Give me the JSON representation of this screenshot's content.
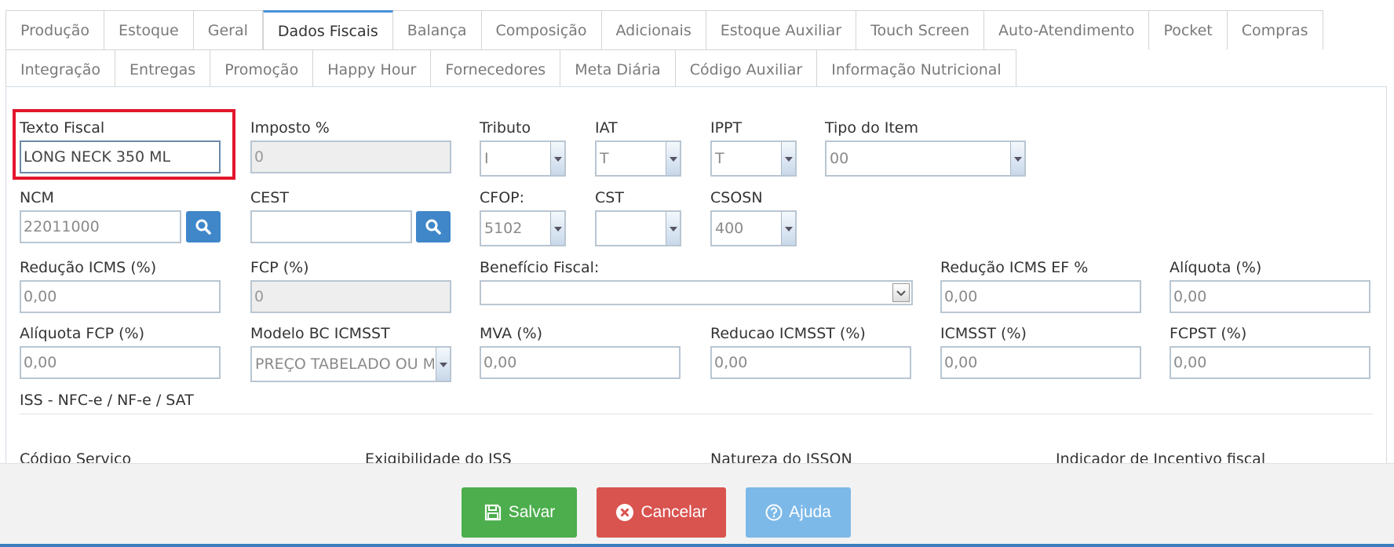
{
  "tabs_row1": [
    "Produção",
    "Estoque",
    "Geral",
    "Dados Fiscais",
    "Balança",
    "Composição",
    "Adicionais",
    "Estoque Auxiliar",
    "Touch Screen",
    "Auto-Atendimento",
    "Pocket",
    "Compras"
  ],
  "tabs_row2": [
    "Integração",
    "Entregas",
    "Promoção",
    "Happy Hour",
    "Fornecedores",
    "Meta Diária",
    "Código Auxiliar",
    "Informação Nutricional"
  ],
  "active_tab": "Dados Fiscais",
  "fields": {
    "texto_fiscal": {
      "label": "Texto Fiscal",
      "value": "LONG NECK 350 ML"
    },
    "imposto": {
      "label": "Imposto %",
      "value": "0"
    },
    "tributo": {
      "label": "Tributo",
      "value": "I"
    },
    "iat": {
      "label": "IAT",
      "value": "T"
    },
    "ippt": {
      "label": "IPPT",
      "value": "T"
    },
    "tipo_item": {
      "label": "Tipo do Item",
      "value": "00"
    },
    "ncm": {
      "label": "NCM",
      "value": "22011000"
    },
    "cest": {
      "label": "CEST",
      "value": ""
    },
    "cfop": {
      "label": "CFOP:",
      "value": "5102"
    },
    "cst": {
      "label": "CST",
      "value": ""
    },
    "csosn": {
      "label": "CSOSN",
      "value": "400"
    },
    "reducao_icms": {
      "label": "Redução ICMS (%)",
      "value": "0,00"
    },
    "fcp": {
      "label": "FCP (%)",
      "value": "0"
    },
    "beneficio_fiscal": {
      "label": "Benefício Fiscal:",
      "value": ""
    },
    "reducao_icms_ef": {
      "label": "Redução ICMS EF %",
      "value": "0,00"
    },
    "aliquota": {
      "label": "Alíquota (%)",
      "value": "0,00"
    },
    "aliquota_fcp": {
      "label": "Alíquota FCP (%)",
      "value": "0,00"
    },
    "modelo_bc": {
      "label": "Modelo BC ICMSST",
      "value": "PREÇO TABELADO OU MÁXIMO SUGERIDO"
    },
    "mva": {
      "label": "MVA (%)",
      "value": "0,00"
    },
    "reducao_icmsst": {
      "label": "Reducao ICMSST (%)",
      "value": "0,00"
    },
    "icmsst": {
      "label": "ICMSST (%)",
      "value": "0,00"
    },
    "fcpst": {
      "label": "FCPST (%)",
      "value": "0,00"
    }
  },
  "iss_section": {
    "title": "ISS - NFC-e / NF-e / SAT",
    "labels": [
      "Código Servico",
      "Exigibilidade do ISS",
      "Natureza do ISSQN",
      "Indicador de Incentivo fiscal"
    ]
  },
  "footer": {
    "save": "Salvar",
    "cancel": "Cancelar",
    "help": "Ajuda"
  },
  "colors": {
    "save": "#4cae4c",
    "cancel": "#d9534f",
    "help": "#7cb9e8",
    "search_button": "#3f87c9",
    "highlight": "#e3162b"
  }
}
